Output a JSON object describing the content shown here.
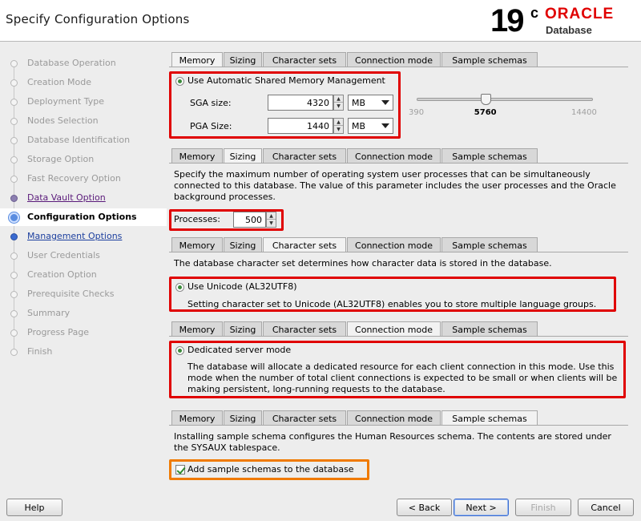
{
  "header": {
    "title": "Specify Configuration Options",
    "logo_version": "19",
    "logo_superscript": "c",
    "logo_brand": "ORACLE",
    "logo_product": "Database"
  },
  "sidebar": {
    "steps": [
      {
        "label": "Database Operation",
        "state": "done"
      },
      {
        "label": "Creation Mode",
        "state": "done"
      },
      {
        "label": "Deployment Type",
        "state": "done"
      },
      {
        "label": "Nodes Selection",
        "state": "done"
      },
      {
        "label": "Database Identification",
        "state": "done"
      },
      {
        "label": "Storage Option",
        "state": "done"
      },
      {
        "label": "Fast Recovery Option",
        "state": "done"
      },
      {
        "label": "Data Vault Option",
        "state": "visited"
      },
      {
        "label": "Configuration Options",
        "state": "current"
      },
      {
        "label": "Management Options",
        "state": "next"
      },
      {
        "label": "User Credentials",
        "state": "pending"
      },
      {
        "label": "Creation Option",
        "state": "pending"
      },
      {
        "label": "Prerequisite Checks",
        "state": "pending"
      },
      {
        "label": "Summary",
        "state": "pending"
      },
      {
        "label": "Progress Page",
        "state": "pending"
      },
      {
        "label": "Finish",
        "state": "pending"
      }
    ]
  },
  "tabs": [
    "Memory",
    "Sizing",
    "Character sets",
    "Connection mode",
    "Sample schemas"
  ],
  "memory": {
    "asmm_label": "Use Automatic Shared Memory Management",
    "sga_label": "SGA size:",
    "sga_value": "4320",
    "sga_unit": "MB",
    "pga_label": "PGA Size:",
    "pga_value": "1440",
    "pga_unit": "MB",
    "slider_min": "390",
    "slider_value": "5760",
    "slider_max": "14400",
    "slider_fraction": 0.39
  },
  "sizing": {
    "description": "Specify the maximum number of operating system user processes that can be simultaneously connected to this database. The value of this parameter includes the user processes and the Oracle background processes.",
    "processes_label": "Processes:",
    "processes_value": "500"
  },
  "charsets": {
    "description": "The database character set determines how character data is stored in the database.",
    "unicode_label": "Use Unicode (AL32UTF8)",
    "unicode_note": "Setting character set to Unicode (AL32UTF8) enables you to store multiple language groups."
  },
  "connection": {
    "dedicated_label": "Dedicated server mode",
    "dedicated_note": "The database will allocate a dedicated resource for each client connection in this mode. Use this mode when the number of total client connections is expected to be small or when clients will be making persistent, long-running requests to the database."
  },
  "samples": {
    "description": "Installing sample schema configures the Human Resources schema. The contents are stored under the SYSAUX tablespace.",
    "checkbox_label": "Add sample schemas to the database"
  },
  "footer": {
    "help": "Help",
    "back": "< Back",
    "next": "Next >",
    "finish": "Finish",
    "cancel": "Cancel"
  }
}
